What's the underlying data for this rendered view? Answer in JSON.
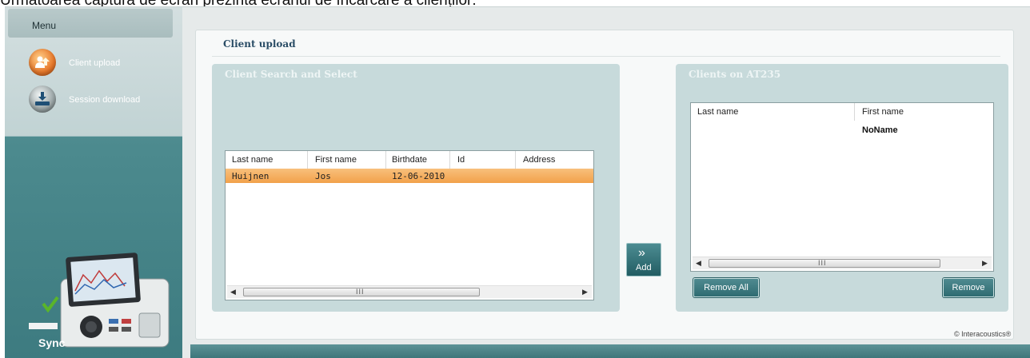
{
  "caption": "Următoarea captură de ecran prezintă ecranul de încărcare a clienților:",
  "sidebar": {
    "menu_label": "Menu",
    "items": [
      {
        "label": "Client upload",
        "icon": "client-upload-icon"
      },
      {
        "label": "Session download",
        "icon": "session-download-icon"
      }
    ],
    "sync_label": "Sync"
  },
  "main": {
    "title": "Client upload",
    "search_group": {
      "title": "Client Search and Select",
      "columns": [
        "Last name",
        "First name",
        "Birthdate",
        "Id",
        "Address"
      ],
      "rows": [
        {
          "last_name": "Huijnen",
          "first_name": "Jos",
          "birthdate": "12-06-2010",
          "id": "",
          "address": ""
        }
      ],
      "scroll_grip": "III"
    },
    "add_button": {
      "label": "Add",
      "icon": "double-chevron-right-icon"
    },
    "device_group": {
      "title": "Clients on AT235",
      "columns": [
        "Last name",
        "First name"
      ],
      "rows": [
        {
          "last_name": "",
          "first_name": "NoName"
        }
      ],
      "scroll_grip": "III",
      "remove_all_label": "Remove All",
      "remove_label": "Remove"
    }
  },
  "footer": {
    "brand": "© Interacoustics®"
  },
  "colors": {
    "accent": "#2f6c72",
    "selection": "#f2a14a",
    "title": "#2a4d66"
  }
}
